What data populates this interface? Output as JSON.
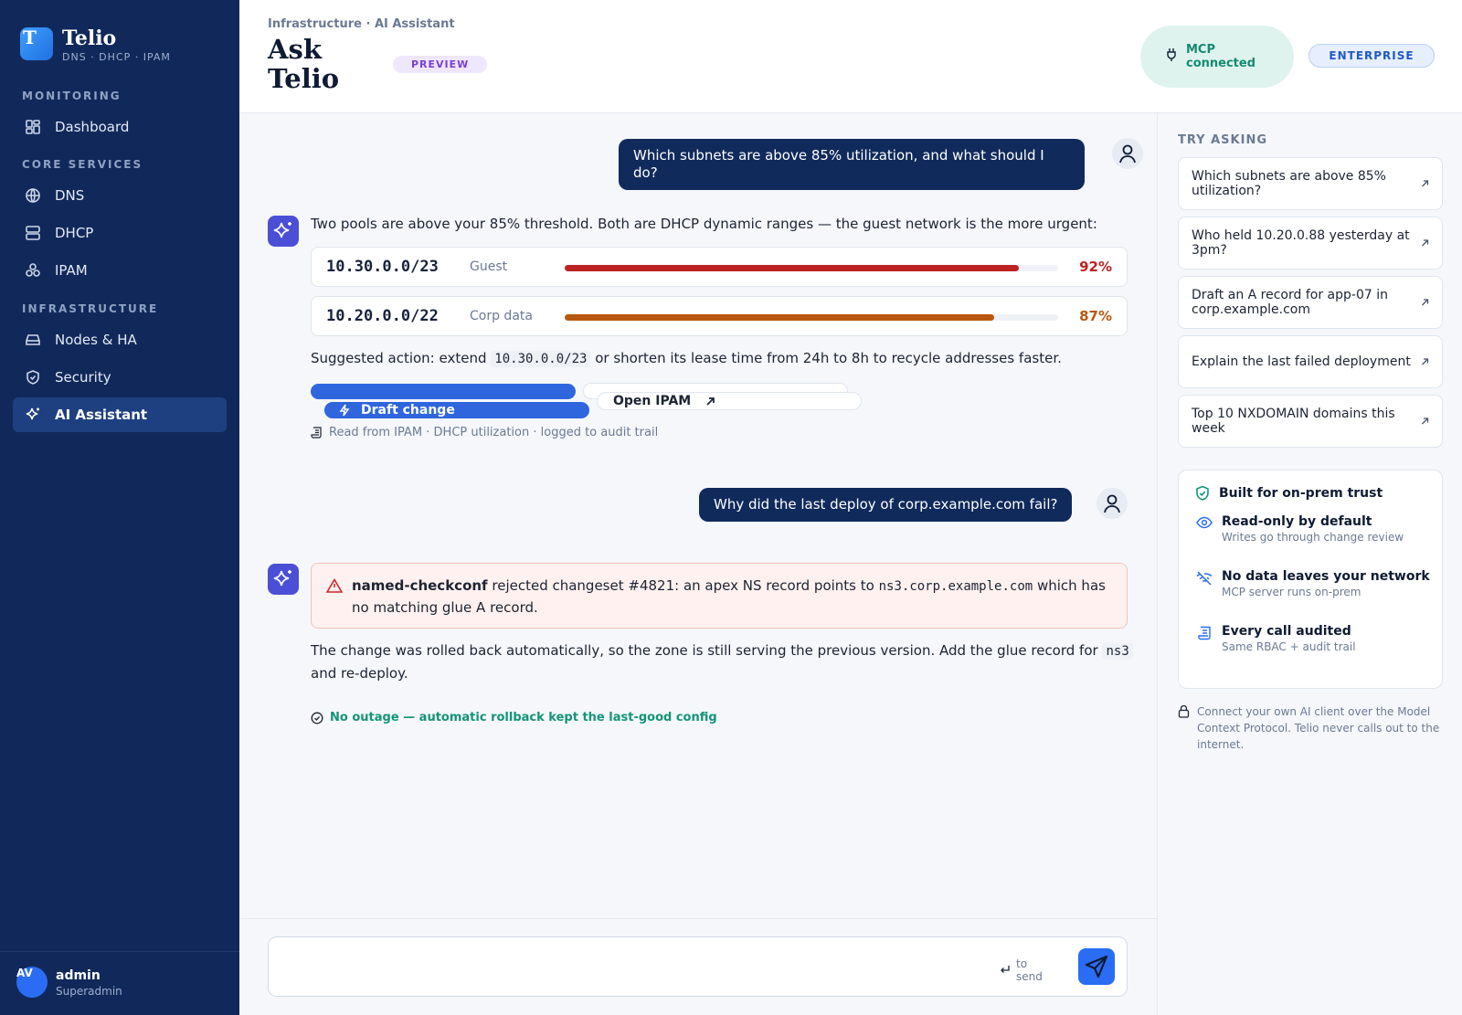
{
  "brand": {
    "logo_letter": "T",
    "name": "Telio",
    "subtitle": "DNS · DHCP · IPAM"
  },
  "sidebar": {
    "sections": [
      {
        "title": "MONITORING",
        "items": [
          {
            "label": "Dashboard",
            "icon": "dashboard-icon"
          }
        ]
      },
      {
        "title": "CORE SERVICES",
        "items": [
          {
            "label": "DNS",
            "icon": "globe-icon"
          },
          {
            "label": "DHCP",
            "icon": "server-icon"
          },
          {
            "label": "IPAM",
            "icon": "network-icon"
          }
        ]
      },
      {
        "title": "INFRASTRUCTURE",
        "items": [
          {
            "label": "Nodes & HA",
            "icon": "drive-icon"
          },
          {
            "label": "Security",
            "icon": "shield-icon"
          },
          {
            "label": "AI Assistant",
            "icon": "sparkle-icon",
            "active": true
          }
        ]
      }
    ],
    "user": {
      "initials": "AV",
      "name": "admin",
      "role": "Superadmin"
    }
  },
  "header": {
    "breadcrumb": "Infrastructure · AI Assistant",
    "title": "Ask Telio",
    "badge": "PREVIEW",
    "mcp_status": "MCP connected",
    "plan": "ENTERPRISE"
  },
  "chat": {
    "q1": "Which subnets are above 85% utilization, and what should I do?",
    "a1_intro": "Two pools are above your 85% threshold. Both are DHCP dynamic ranges — the guest network is the more urgent:",
    "pools": [
      {
        "subnet": "10.30.0.0/23",
        "label": "Guest",
        "utilization": 92,
        "pct_label": "92%",
        "color": "#bd2323"
      },
      {
        "subnet": "10.20.0.0/22",
        "label": "Corp data",
        "utilization": 87,
        "pct_label": "87%",
        "color": "#b8570f"
      }
    ],
    "action_prefix": "Suggested action: extend",
    "action_code": "10.30.0.0/23",
    "action_suffix": "or shorten its lease time from 24h to 8h to recycle addresses faster.",
    "draft_button": "Draft change",
    "open_button": "Open IPAM",
    "source_note": "Read from IPAM · DHCP utilization · logged to audit trail",
    "q2": "Why did the last deploy of corp.example.com fail?",
    "error_tool": "named-checkconf",
    "error_text_a": "rejected changeset #4821: an apex NS record points to",
    "error_code": "ns3.corp.example.com",
    "error_text_b": "which has no matching glue A record.",
    "a2_text_a": "The change was rolled back automatically, so the zone is still serving the previous version. Add the glue record for",
    "a2_code": "ns3",
    "a2_text_b": "and re-deploy.",
    "ok_note": "No outage — automatic rollback kept the last-good config"
  },
  "composer": {
    "placeholder": "",
    "hint": "to send"
  },
  "right_panel": {
    "title": "TRY ASKING",
    "suggestions": [
      "Which subnets are above 85% utilization?",
      "Who held 10.20.0.88 yesterday at 3pm?",
      "Draft an A record for app-07 in corp.example.com",
      "Explain the last failed deployment",
      "Top 10 NXDOMAIN domains this week"
    ],
    "trust": {
      "title": "Built for on-prem trust",
      "items": [
        {
          "title": "Read-only by default",
          "sub": "Writes go through change review",
          "icon": "eye-icon"
        },
        {
          "title": "No data leaves your network",
          "sub": "MCP server runs on-prem",
          "icon": "wifi-off-icon"
        },
        {
          "title": "Every call audited",
          "sub": "Same RBAC + audit trail",
          "icon": "scroll-icon"
        }
      ]
    },
    "mcp_note": "Connect your own AI client over the Model Context Protocol. Telio never calls out to the internet."
  },
  "colors": {
    "sidebar": "#11295a",
    "accent": "#2a6df4",
    "user_bubble": "#102a5c",
    "success": "#149478",
    "danger": "#bd2323"
  }
}
